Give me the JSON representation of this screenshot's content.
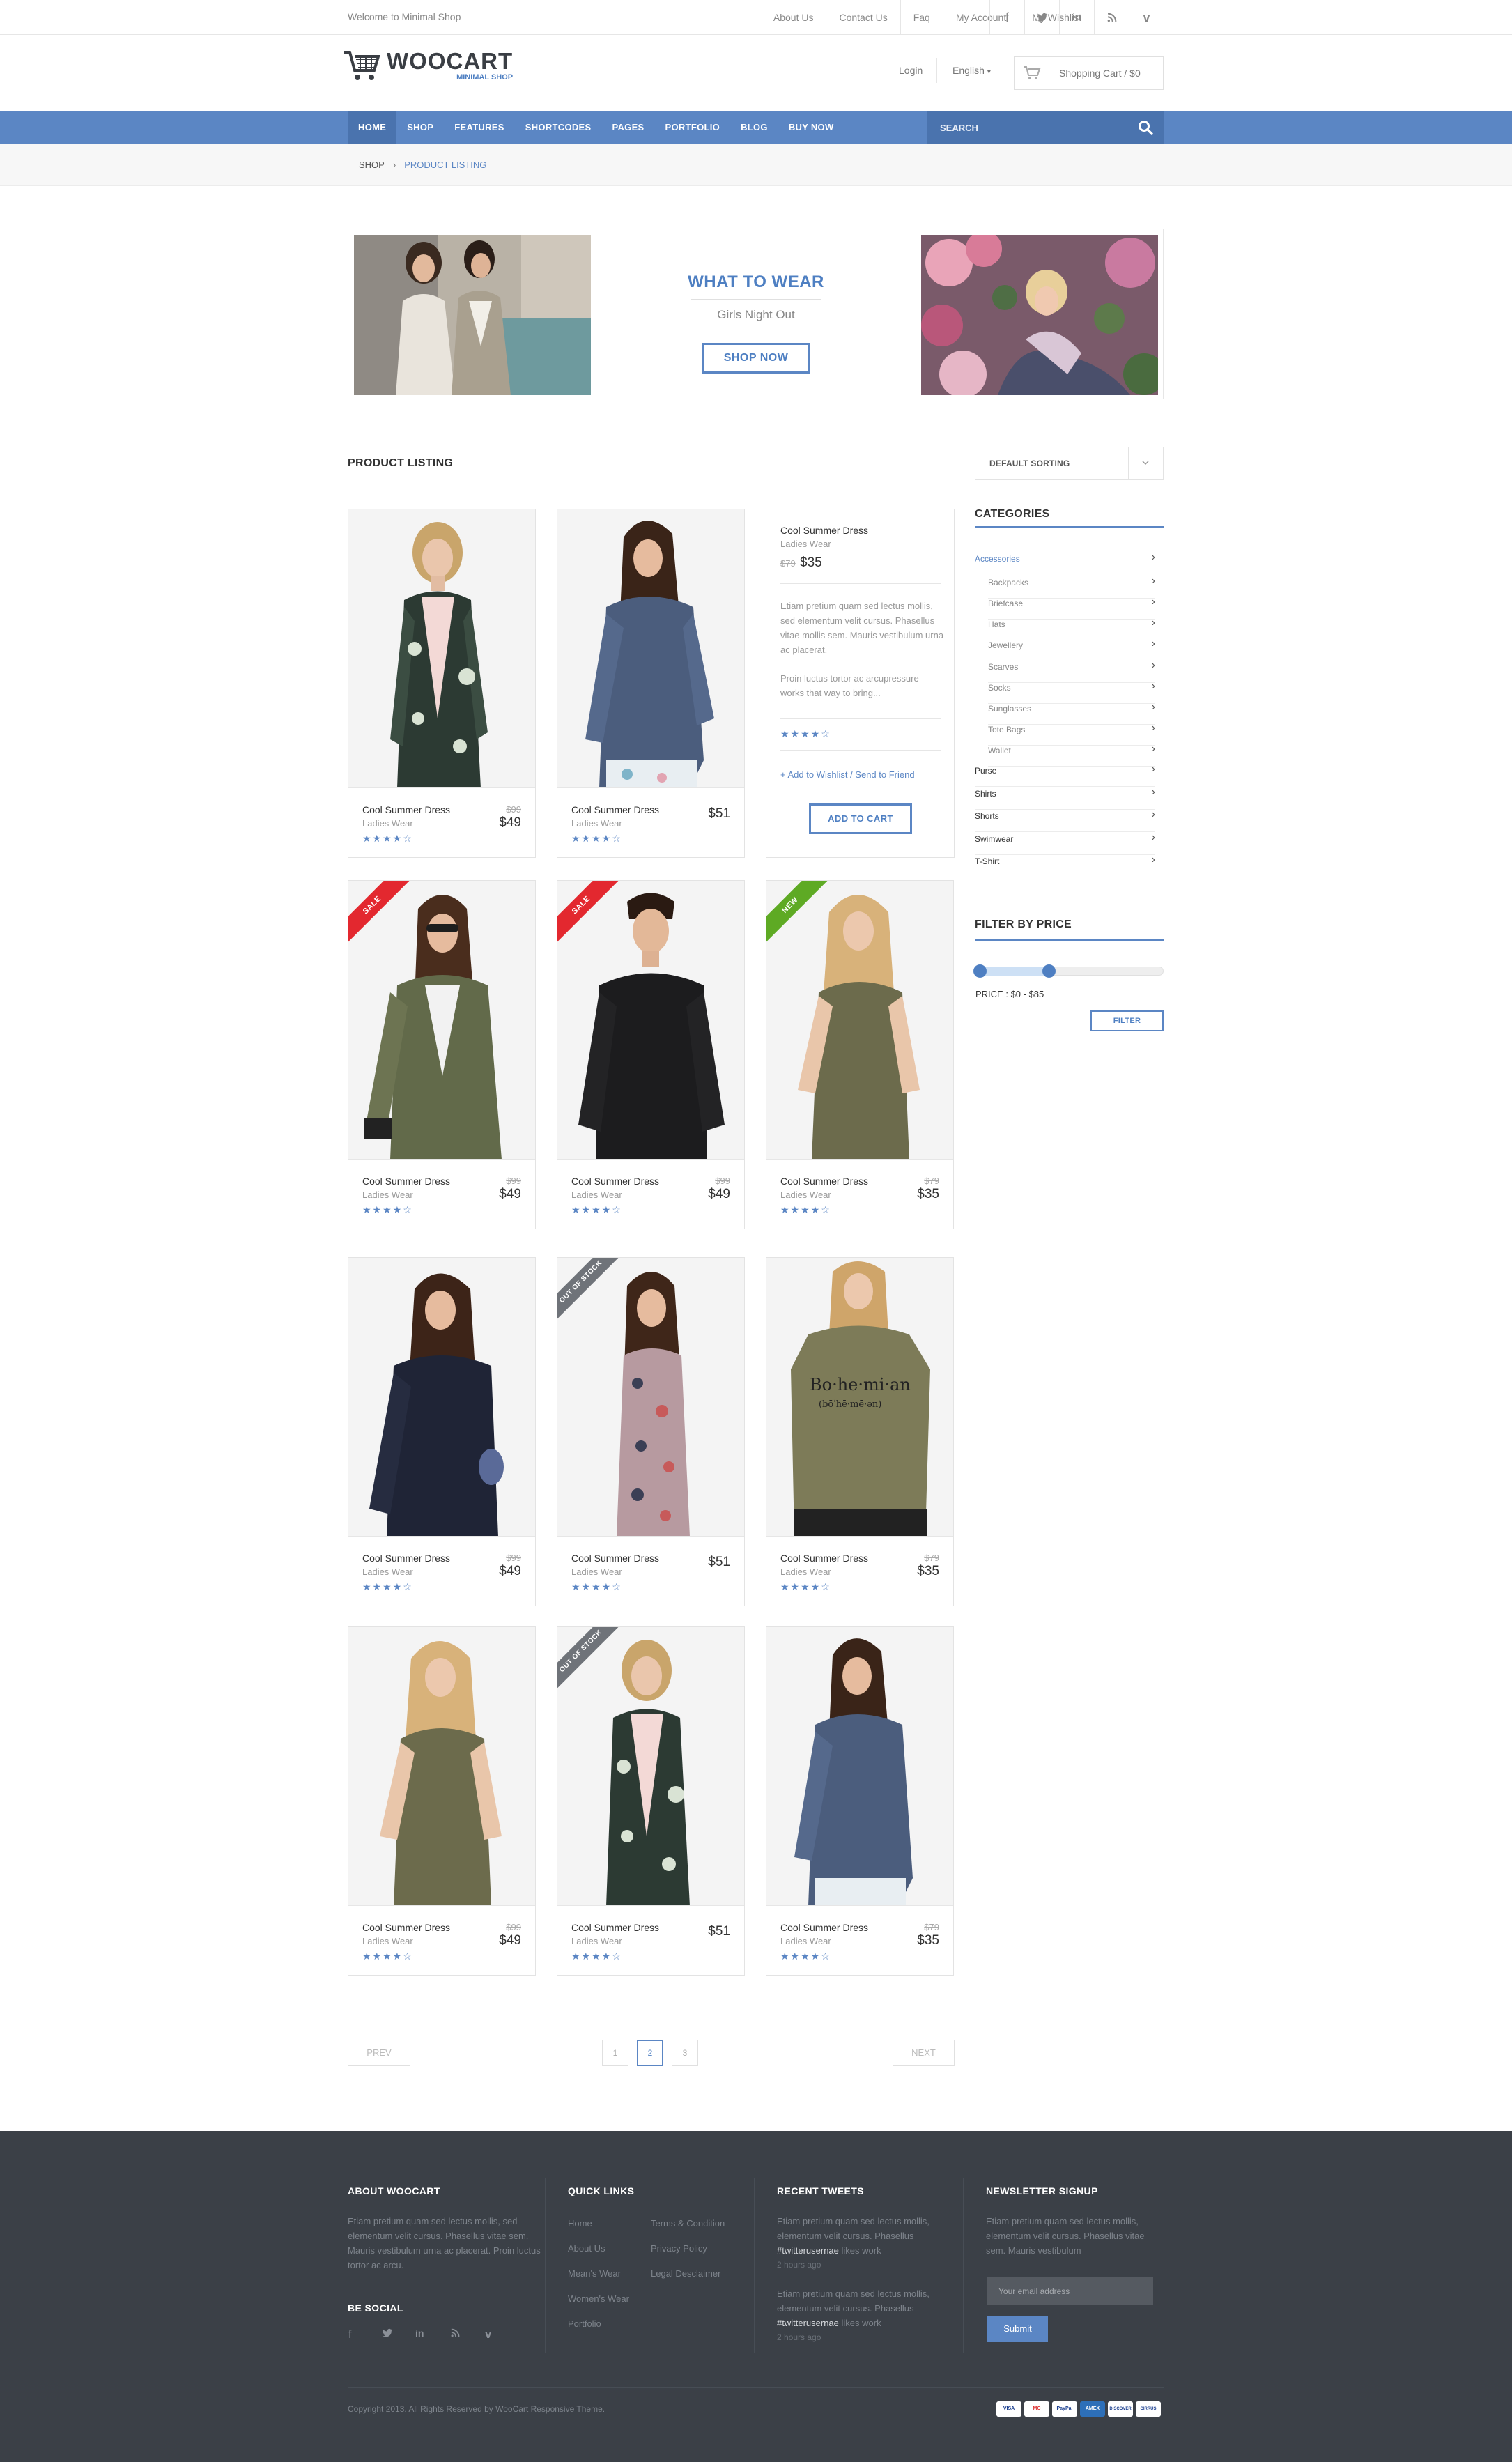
{
  "topbar": {
    "welcome": "Welcome to Minimal Shop",
    "links": [
      "About Us",
      "Contact Us",
      "Faq",
      "My Account",
      "My Wishlist"
    ],
    "social": [
      "facebook-icon",
      "twitter-icon",
      "linkedin-icon",
      "rss-icon",
      "vimeo-icon"
    ]
  },
  "header": {
    "logo_title": "WOOCART",
    "logo_sub": "MINIMAL SHOP",
    "login": "Login",
    "language": "English",
    "cart": "Shopping Cart / $0"
  },
  "nav": {
    "items": [
      "HOME",
      "SHOP",
      "FEATURES",
      "SHORTCODES",
      "PAGES",
      "PORTFOLIO",
      "BLOG",
      "BUY NOW"
    ],
    "active": "HOME",
    "search_placeholder": "SEARCH"
  },
  "breadcrumb": {
    "items": [
      "SHOP",
      "PRODUCT LISTING"
    ]
  },
  "promo": {
    "title": "WHAT TO WEAR",
    "subtitle": "Girls Night Out",
    "button": "SHOP NOW"
  },
  "listing": {
    "title": "PRODUCT LISTING",
    "sort": "DEFAULT SORTING"
  },
  "products": [
    {
      "name": "Cool Summer Dress",
      "category": "Ladies Wear",
      "old_price": "$99",
      "price": "$49",
      "rating": 4,
      "badge": ""
    },
    {
      "name": "Cool Summer Dress",
      "category": "Ladies Wear",
      "old_price": "",
      "price": "$51",
      "rating": 4,
      "badge": ""
    },
    {
      "name": "Cool Summer Dress",
      "category": "Ladies Wear",
      "old_price": "$99",
      "price": "$49",
      "rating": 4,
      "badge": "SALE"
    },
    {
      "name": "Cool Summer Dress",
      "category": "Ladies Wear",
      "old_price": "$99",
      "price": "$49",
      "rating": 4,
      "badge": "SALE"
    },
    {
      "name": "Cool Summer Dress",
      "category": "Ladies Wear",
      "old_price": "$79",
      "price": "$35",
      "rating": 4,
      "badge": "NEW"
    },
    {
      "name": "Cool Summer Dress",
      "category": "Ladies Wear",
      "old_price": "$99",
      "price": "$49",
      "rating": 4,
      "badge": ""
    },
    {
      "name": "Cool Summer Dress",
      "category": "Ladies Wear",
      "old_price": "",
      "price": "$51",
      "rating": 4,
      "badge": "OUT OF STOCK"
    },
    {
      "name": "Cool Summer Dress",
      "category": "Ladies Wear",
      "old_price": "$79",
      "price": "$35",
      "rating": 4,
      "badge": ""
    },
    {
      "name": "Cool Summer Dress",
      "category": "Ladies Wear",
      "old_price": "$99",
      "price": "$49",
      "rating": 4,
      "badge": ""
    },
    {
      "name": "Cool Summer Dress",
      "category": "Ladies Wear",
      "old_price": "",
      "price": "$51",
      "rating": 4,
      "badge": "OUT OF STOCK"
    },
    {
      "name": "Cool Summer Dress",
      "category": "Ladies Wear",
      "old_price": "$79",
      "price": "$35",
      "rating": 4,
      "badge": ""
    }
  ],
  "detail": {
    "name": "Cool Summer Dress",
    "category": "Ladies Wear",
    "old_price": "$79",
    "price": "$35",
    "desc1": "Etiam pretium quam sed lectus mollis, sed elementum velit cursus. Phasellus vitae mollis sem. Mauris vestibulum urna ac placerat.",
    "desc2": "Proin luctus tortor ac arcupressure works that way to bring...",
    "rating": 4,
    "links": "+ Add to Wishlist / Send to Friend",
    "button": "ADD TO CART"
  },
  "sidebar": {
    "categories_title": "CATEGORIES",
    "categories": [
      {
        "label": "Accessories",
        "sub": false,
        "active": true
      },
      {
        "label": "Backpacks",
        "sub": true
      },
      {
        "label": "Briefcase",
        "sub": true
      },
      {
        "label": "Hats",
        "sub": true
      },
      {
        "label": "Jewellery",
        "sub": true
      },
      {
        "label": "Scarves",
        "sub": true
      },
      {
        "label": "Socks",
        "sub": true
      },
      {
        "label": "Sunglasses",
        "sub": true
      },
      {
        "label": "Tote Bags",
        "sub": true
      },
      {
        "label": "Wallet",
        "sub": true
      },
      {
        "label": "Purse",
        "sub": false
      },
      {
        "label": "Shirts",
        "sub": false
      },
      {
        "label": "Shorts",
        "sub": false
      },
      {
        "label": "Swimwear",
        "sub": false
      },
      {
        "label": "T-Shirt",
        "sub": false
      }
    ],
    "price_title": "FILTER BY PRICE",
    "price_label": "PRICE : $0 - $85",
    "filter_button": "FILTER"
  },
  "pagination": {
    "prev": "PREV",
    "next": "NEXT",
    "pages": [
      "1",
      "2",
      "3"
    ],
    "current": "2"
  },
  "footer": {
    "about_title": "ABOUT WOOCART",
    "about_text": "Etiam pretium quam sed lectus mollis, sed elementum velit cursus. Phasellus vitae sem. Mauris vestibulum urna ac placerat. Proin luctus tortor ac arcu.",
    "social_title": "BE SOCIAL",
    "links_title": "QUICK LINKS",
    "links_col1": [
      "Home",
      "About Us",
      "Mean's Wear",
      "Women's Wear",
      "Portfolio"
    ],
    "links_col2": [
      "Terms & Condition",
      "Privacy Policy",
      "Legal Desclaimer"
    ],
    "tweets_title": "RECENT TWEETS",
    "tweets": [
      {
        "text": "Etiam pretium quam sed lectus mollis, elementum velit cursus. Phasellus",
        "user": "#twitterusernae",
        "suffix": "likes work",
        "time": "2 hours ago"
      },
      {
        "text": "Etiam pretium quam sed lectus mollis, elementum velit cursus. Phasellus",
        "user": "#twitterusernae",
        "suffix": "likes work",
        "time": "2 hours ago"
      }
    ],
    "newsletter_title": "NEWSLETTER SIGNUP",
    "newsletter_text": "Etiam pretium quam sed lectus mollis, elementum velit cursus. Phasellus vitae sem. Mauris vestibulum",
    "newsletter_placeholder": "Your email address",
    "newsletter_button": "Submit",
    "copyright": "Copyright 2013. All Rights Reserved by WooCart Responsive Theme.",
    "payments": [
      "VISA",
      "MC",
      "PayPal",
      "AMEX",
      "DISCOVER",
      "CIRRUS"
    ]
  },
  "colors": {
    "accent": "#5b86c4",
    "footer_bg": "#3b4047",
    "sale": "#e3282f",
    "new": "#5eaa24",
    "out_of_stock": "#6f7379"
  }
}
